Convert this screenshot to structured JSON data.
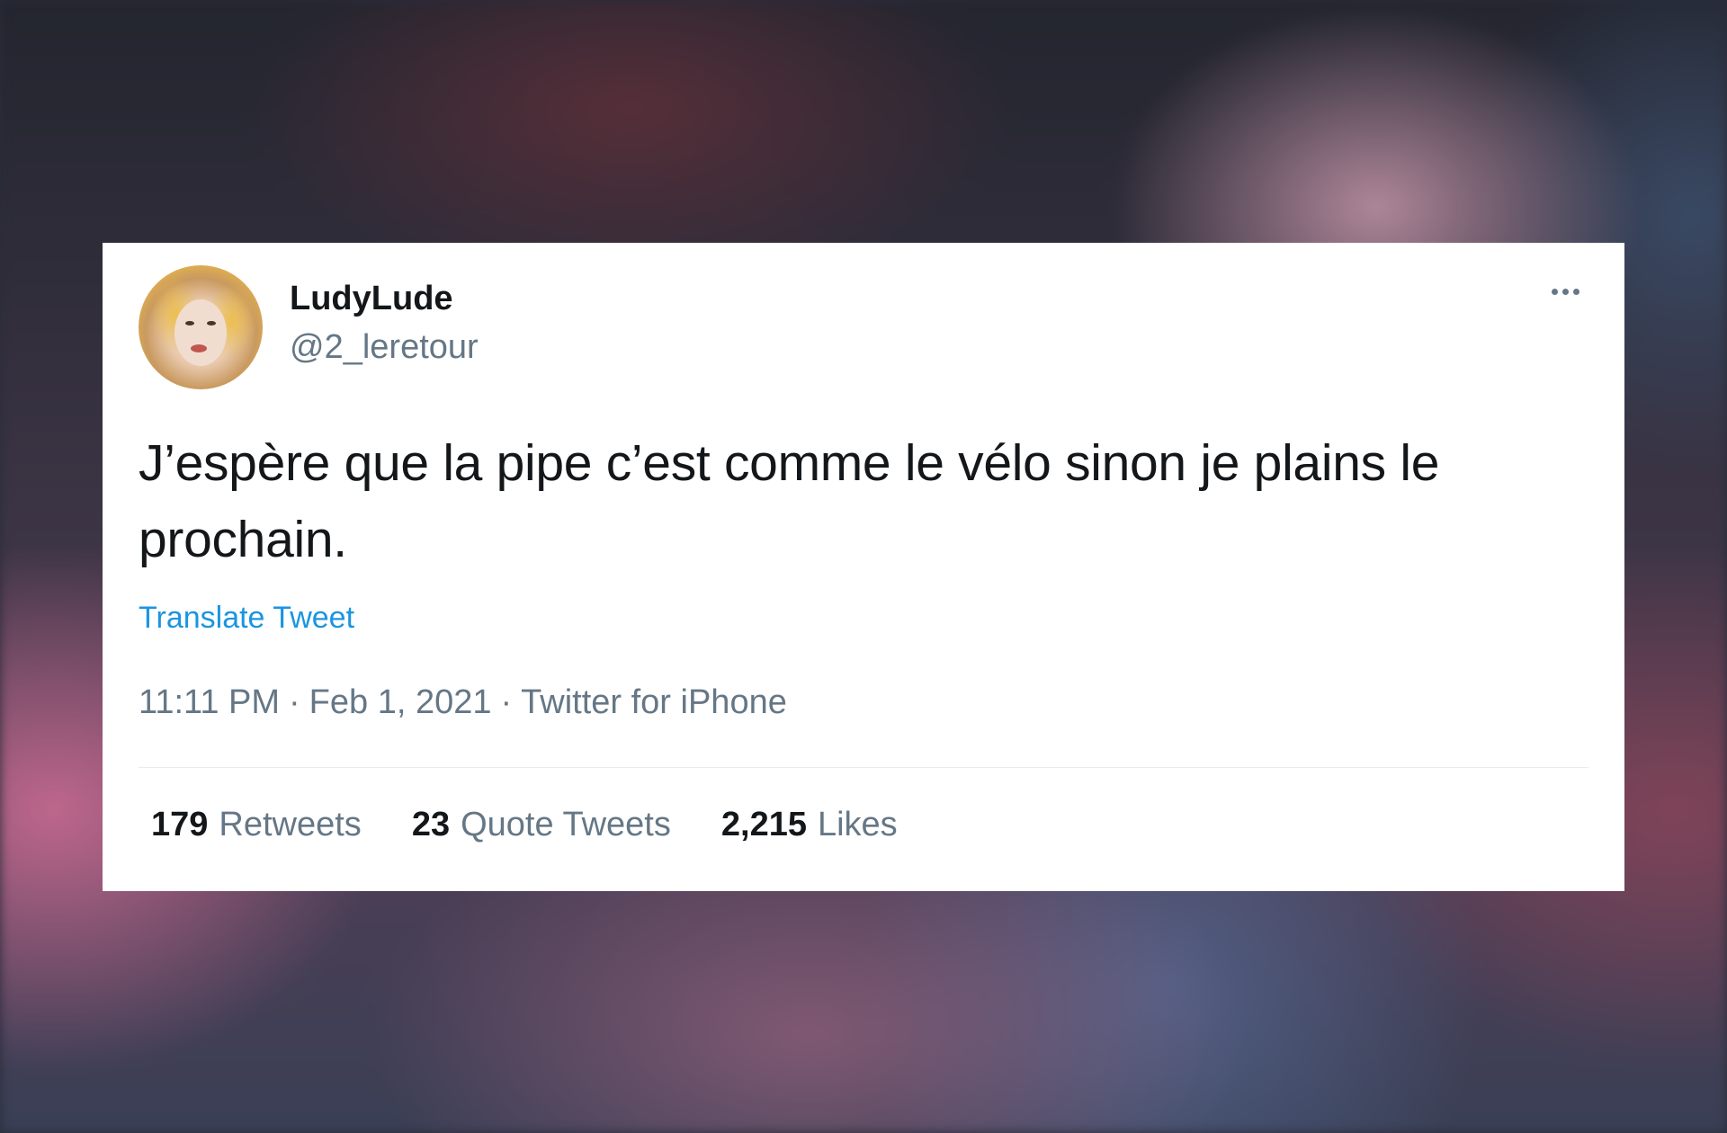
{
  "tweet": {
    "author": {
      "display_name": "LudyLude",
      "handle": "@2_leretour"
    },
    "more_icon": "more-horizontal-icon",
    "text": "J’espère que la pipe c’est comme le vélo sinon je plains le prochain.",
    "translate_label": "Translate Tweet",
    "time": "11:11 PM",
    "date": "Feb 1, 2021",
    "source": "Twitter for iPhone",
    "separator": "·",
    "stats": {
      "retweets_count": "179",
      "retweets_label": "Retweets",
      "quotes_count": "23",
      "quotes_label": "Quote Tweets",
      "likes_count": "2,215",
      "likes_label": "Likes"
    }
  },
  "colors": {
    "text_primary": "#14171a",
    "text_secondary": "#657786",
    "link": "#1b95e0",
    "divider": "#e6ecf0"
  }
}
